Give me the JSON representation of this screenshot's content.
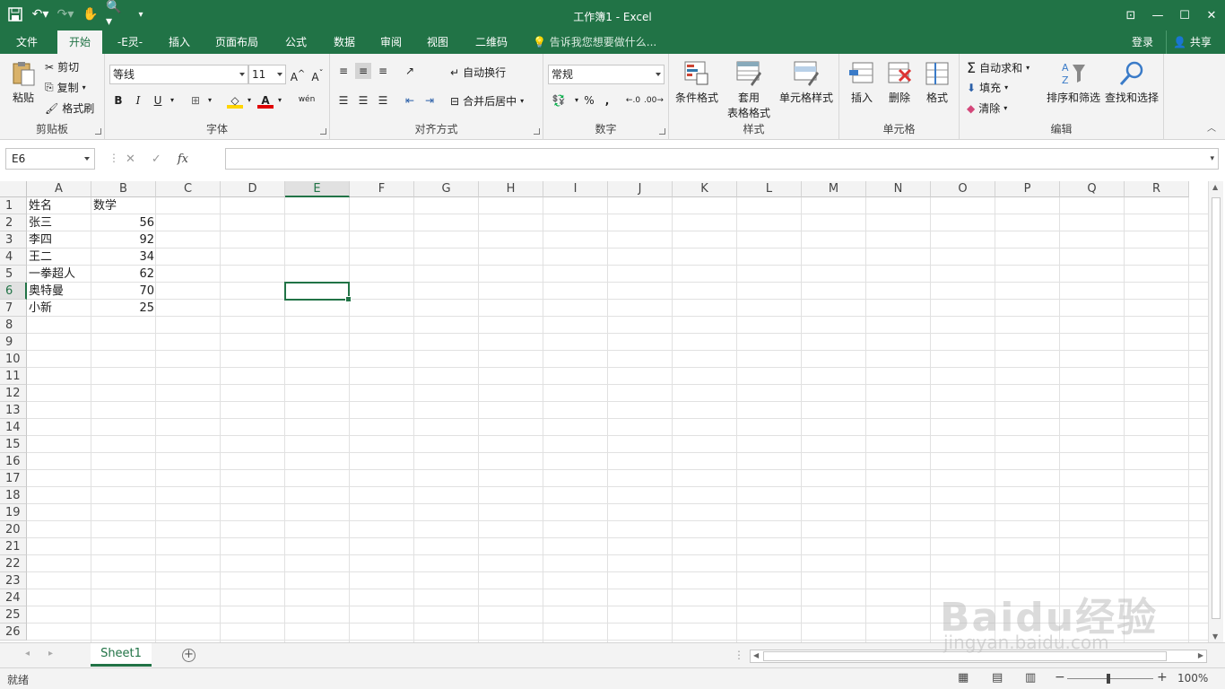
{
  "window": {
    "title": "工作簿1 - Excel"
  },
  "tabs": [
    "文件",
    "开始",
    "-E灵-",
    "插入",
    "页面布局",
    "公式",
    "数据",
    "审阅",
    "视图",
    "二维码"
  ],
  "tell_me": "告诉我您想要做什么...",
  "login": "登录",
  "share": "共享",
  "ribbon": {
    "clipboard": {
      "label": "剪贴板",
      "paste": "粘贴",
      "cut": "剪切",
      "copy": "复制",
      "format_painter": "格式刷"
    },
    "font": {
      "label": "字体",
      "name": "等线",
      "size": "11",
      "bold": "B",
      "italic": "I",
      "underline": "U",
      "phonetic": "wén"
    },
    "alignment": {
      "label": "对齐方式",
      "wrap": "自动换行",
      "merge": "合并后居中"
    },
    "number": {
      "label": "数字",
      "format": "常规",
      "percent": "%",
      "comma": ","
    },
    "styles": {
      "label": "样式",
      "conditional": "条件格式",
      "table_format_1": "套用",
      "table_format_2": "表格格式",
      "cell_styles": "单元格样式"
    },
    "cells": {
      "label": "单元格",
      "insert": "插入",
      "delete": "删除",
      "format": "格式"
    },
    "editing": {
      "label": "编辑",
      "autosum": "自动求和",
      "fill": "填充",
      "clear": "清除",
      "sort": "排序和筛选",
      "find": "查找和选择"
    }
  },
  "formula_bar": {
    "name_box": "E6",
    "cancel": "✕",
    "enter": "✓",
    "fx": "fx",
    "content": ""
  },
  "columns": [
    "A",
    "B",
    "C",
    "D",
    "E",
    "F",
    "G",
    "H",
    "I",
    "J",
    "K",
    "L",
    "M",
    "N",
    "O",
    "P",
    "Q",
    "R"
  ],
  "selected": {
    "column": "E",
    "row": 6
  },
  "table": {
    "headers": [
      "姓名",
      "数学"
    ],
    "rows": [
      [
        "张三",
        "56"
      ],
      [
        "李四",
        "92"
      ],
      [
        "王二",
        "34"
      ],
      [
        "一拳超人",
        "62"
      ],
      [
        "奥特曼",
        "70"
      ],
      [
        "小新",
        "25"
      ]
    ]
  },
  "row_count": 26,
  "sheet": {
    "name": "Sheet1"
  },
  "status": {
    "text": "就绪",
    "zoom": "100%"
  },
  "watermark": {
    "main": "Baidu经验",
    "sub": "jingyan.baidu.com"
  }
}
